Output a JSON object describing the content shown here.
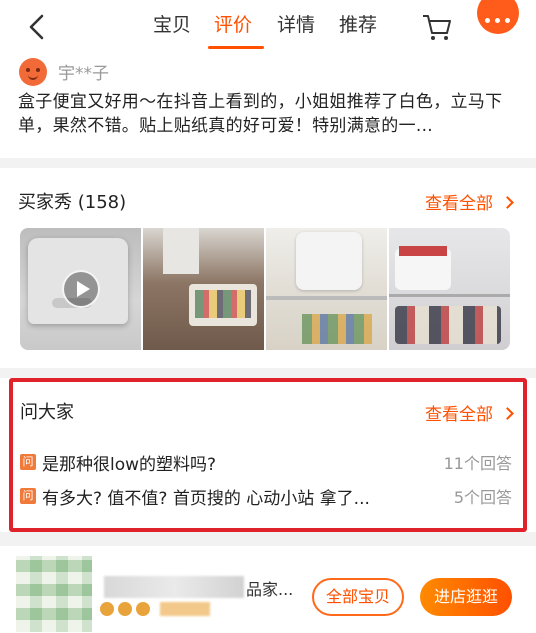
{
  "header": {
    "tabs": [
      {
        "label": "宝贝",
        "active": false
      },
      {
        "label": "评价",
        "active": true
      },
      {
        "label": "详情",
        "active": false
      },
      {
        "label": "推荐",
        "active": false
      }
    ],
    "icons": {
      "back": "back-arrow-icon",
      "cart": "cart-icon",
      "more": "more-icon"
    },
    "accent_color": "#ff5000"
  },
  "review": {
    "username": "宇**子",
    "text": "盒子便宜又好用～在抖音上看到的，小姐姐推荐了白色，立马下单，果然不错。贴上贴纸真的好可爱！特别满意的一..."
  },
  "buyer_show": {
    "title": "买家秀 (158)",
    "view_all": "查看全部",
    "photos": [
      "video-thumbnail",
      "photo",
      "photo",
      "photo"
    ]
  },
  "ask_everyone": {
    "title": "问大家",
    "view_all": "查看全部",
    "question_icon": "问",
    "questions": [
      {
        "text": "是那种很low的塑料吗?",
        "answers": "11个回答"
      },
      {
        "text": "有多大? 值不值? 首页搜的 心动小站 拿了...",
        "answers": "5个回答"
      }
    ],
    "highlight_color": "#e0232b"
  },
  "shop": {
    "name_visible": "品家...",
    "all_items_button": "全部宝贝",
    "enter_shop_button": "进店逛逛"
  }
}
